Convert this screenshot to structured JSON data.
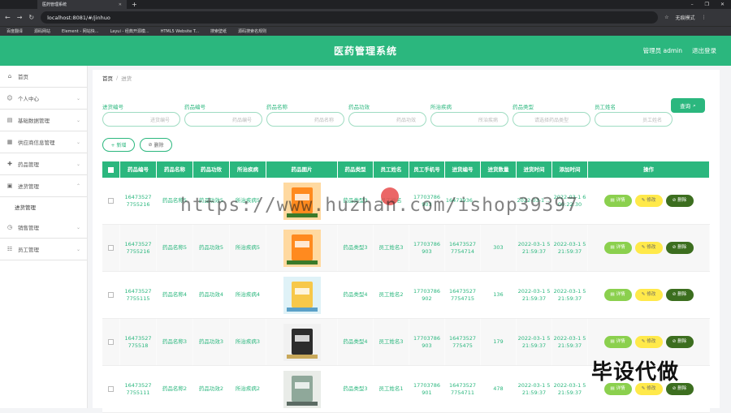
{
  "browser": {
    "tab_title": "医药管理系统",
    "url": "localhost:8081/#/jinhuo",
    "mode_label": "无痕模式",
    "bookmarks": [
      "百度翻译",
      "源码网站",
      "Element - 网站快...",
      "Layui - 经典开源模...",
      "HTML5 Website T...",
      "搜索壁纸",
      "源码搜索名规则"
    ]
  },
  "header": {
    "title": "医药管理系统",
    "user_label": "管理员 admin",
    "logout_label": "退出登录"
  },
  "sidebar": {
    "items": [
      {
        "label": "首页",
        "icon": "home-icon",
        "has_chevron": false
      },
      {
        "label": "个人中心",
        "icon": "user-icon",
        "has_chevron": true
      },
      {
        "label": "基础数据管理",
        "icon": "data-icon",
        "has_chevron": true
      },
      {
        "label": "供应商信息管理",
        "icon": "supplier-icon",
        "has_chevron": true
      },
      {
        "label": "药品管理",
        "icon": "medicine-icon",
        "has_chevron": true
      },
      {
        "label": "进货管理",
        "icon": "stock-icon",
        "has_chevron": true,
        "expanded": true,
        "sub": [
          "进货管理"
        ]
      },
      {
        "label": "销售管理",
        "icon": "sales-icon",
        "has_chevron": true
      },
      {
        "label": "员工管理",
        "icon": "staff-icon",
        "has_chevron": true
      }
    ]
  },
  "breadcrumb": {
    "home": "首页",
    "sep": "/",
    "current": "进货"
  },
  "filters": [
    {
      "label": "进货编号",
      "placeholder": "进货编号"
    },
    {
      "label": "药品编号",
      "placeholder": "药品编号"
    },
    {
      "label": "药品名称",
      "placeholder": "药品名称"
    },
    {
      "label": "药品功效",
      "placeholder": "药品功效"
    },
    {
      "label": "所治疾病",
      "placeholder": "所治疾病"
    },
    {
      "label": "药品类型",
      "placeholder": "请选择药品类型"
    },
    {
      "label": "员工姓名",
      "placeholder": "员工姓名"
    }
  ],
  "search_label": "查询",
  "actions": {
    "add": "+ 新增",
    "delete": "删除"
  },
  "table": {
    "headers": [
      "药品编号",
      "药品名称",
      "药品功效",
      "所治疾病",
      "药品图片",
      "药品类型",
      "员工姓名",
      "员工手机号",
      "进货编号",
      "进货数量",
      "进货时间",
      "添加时间",
      "操作"
    ],
    "rows": [
      {
        "code": "16473527 7755216",
        "name": "药品名称5",
        "effect": "药品功效5",
        "disease": "所治疾病5",
        "type": "药品类型3",
        "staff": "员工姓名",
        "phone": "17703786 903",
        "stock_no": "16473936 ...",
        "qty": "",
        "stock_time": "2022-03-1 ...",
        "add_time": "2022-03-1 6 09:22:30",
        "img": "orange"
      },
      {
        "code": "16473527 7755216",
        "name": "药品名称5",
        "effect": "药品功效5",
        "disease": "所治疾病5",
        "type": "药品类型3",
        "staff": "员工姓名3",
        "phone": "17703786 903",
        "stock_no": "16473527 7754714",
        "qty": "303",
        "stock_time": "2022-03-1 5 21:59:37",
        "add_time": "2022-03-1 5 21:59:37",
        "img": "orange"
      },
      {
        "code": "16473527 7755115",
        "name": "药品名称4",
        "effect": "药品功效4",
        "disease": "所治疾病4",
        "type": "药品类型4",
        "staff": "员工姓名2",
        "phone": "17703786 902",
        "stock_no": "16473527 7754715",
        "qty": "136",
        "stock_time": "2022-03-1 5 21:59:37",
        "add_time": "2022-03-1 5 21:59:37",
        "img": "box"
      },
      {
        "code": "16473527 775518",
        "name": "药品名称3",
        "effect": "药品功效3",
        "disease": "所治疾病3",
        "type": "药品类型4",
        "staff": "员工姓名3",
        "phone": "17703786 903",
        "stock_no": "16473527 775475",
        "qty": "179",
        "stock_time": "2022-03-1 5 21:59:37",
        "add_time": "2022-03-1 5 21:59:37",
        "img": "dark"
      },
      {
        "code": "16473527 7755111",
        "name": "药品名称2",
        "effect": "药品功效2",
        "disease": "所治疾病2",
        "type": "药品类型3",
        "staff": "员工姓名1",
        "phone": "17703786 901",
        "stock_no": "16473527 7754711",
        "qty": "478",
        "stock_time": "2022-03-1 5 21:59:37",
        "add_time": "2022-03-1 5 21:59:37",
        "img": "gray"
      }
    ],
    "row_actions": {
      "view": "详情",
      "edit": "修改",
      "delete": "删除"
    }
  },
  "watermark": "https://www.huzhan.com/ishop39397",
  "stamp": "毕设代做",
  "colors": {
    "accent": "#2bb77e",
    "view": "#8bd04e",
    "edit": "#ffe94a",
    "delete": "#3c6e1f"
  }
}
